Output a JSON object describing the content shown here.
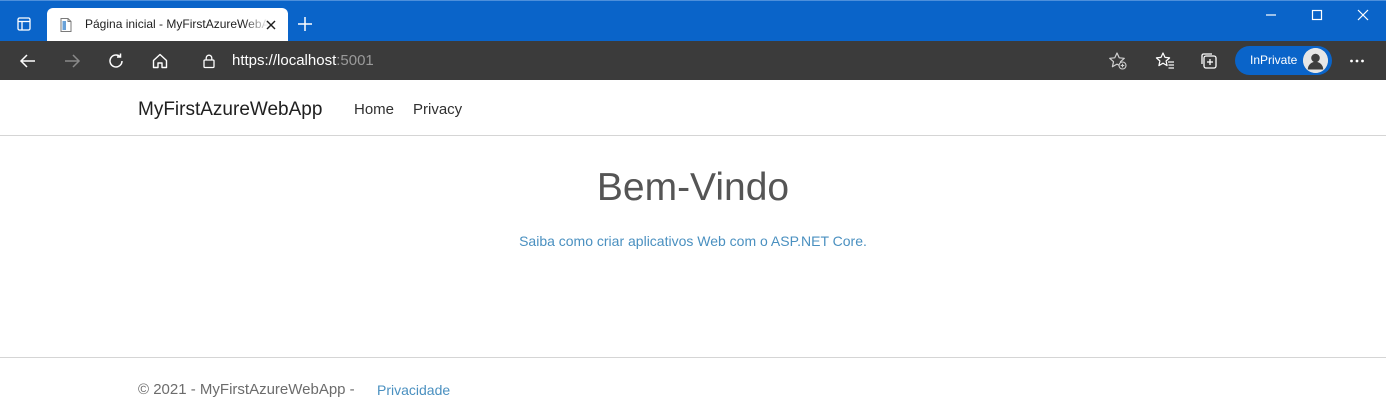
{
  "browser": {
    "tab": {
      "title": "Página inicial - MyFirstAzureWebApp"
    },
    "address": {
      "scheme": "https://",
      "host": "localhost",
      "port": ":5001"
    },
    "inprivate_label": "InPrivate",
    "colors": {
      "tab_strip": "#0a64c9",
      "toolbar": "#3b3b3b",
      "accent": "#0a64c9"
    },
    "icons": [
      "tab-actions-icon",
      "page-favicon-icon",
      "close-tab-icon",
      "new-tab-icon",
      "minimize-icon",
      "maximize-icon",
      "close-window-icon",
      "back-icon",
      "forward-icon",
      "refresh-icon",
      "home-icon",
      "lock-icon",
      "add-favorite-icon",
      "favorites-icon",
      "collections-icon",
      "profile-avatar-icon",
      "more-icon"
    ]
  },
  "site": {
    "brand": "MyFirstAzureWebApp",
    "nav": [
      {
        "label": "Home"
      },
      {
        "label": "Privacy"
      }
    ],
    "hero": {
      "title": "Bem-Vindo",
      "text": "Saiba como criar aplicativos Web com o ASP.NET Core."
    },
    "footer": {
      "copyright": "© 2021 - MyFirstAzureWebApp -",
      "privacy_link": "Privacidade"
    },
    "colors": {
      "link": "#4a90c0",
      "heading": "#555555"
    }
  }
}
